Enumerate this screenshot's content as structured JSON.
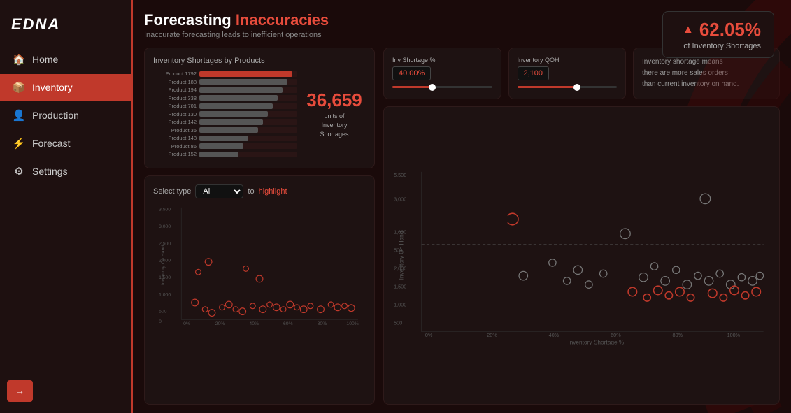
{
  "sidebar": {
    "logo": "EDNA",
    "nav_items": [
      {
        "id": "home",
        "label": "Home",
        "icon": "🏠",
        "active": false
      },
      {
        "id": "inventory",
        "label": "Inventory",
        "icon": "📦",
        "active": true
      },
      {
        "id": "production",
        "label": "Production",
        "icon": "👤",
        "active": false
      },
      {
        "id": "forecast",
        "label": "Forecast",
        "icon": "⚡",
        "active": false
      },
      {
        "id": "settings",
        "label": "Settings",
        "icon": "⚙",
        "active": false
      }
    ],
    "logout_icon": "→"
  },
  "header": {
    "title_plain": "Forecasting ",
    "title_accent": "Inaccuracies",
    "subtitle": "Inaccurate forecasting leads to inefficient operations"
  },
  "badge": {
    "icon": "▲",
    "percent": "62.05%",
    "label": "of Inventory Shortages"
  },
  "inventory_card": {
    "title": "Inventory Shortages by Products",
    "products": [
      {
        "name": "Product 1792",
        "pct": 95
      },
      {
        "name": "Product 188",
        "pct": 90
      },
      {
        "name": "Product 194",
        "pct": 85
      },
      {
        "name": "Product 338",
        "pct": 80
      },
      {
        "name": "Product 701",
        "pct": 75
      },
      {
        "name": "Product 130",
        "pct": 70
      },
      {
        "name": "Product 142",
        "pct": 65
      },
      {
        "name": "Product 35",
        "pct": 60
      },
      {
        "name": "Product 148",
        "pct": 50
      },
      {
        "name": "Product 86",
        "pct": 45
      },
      {
        "name": "Product 152",
        "pct": 40
      }
    ],
    "stat_number": "36,659",
    "stat_label": "units of\nInventory\nShortages"
  },
  "select_type": {
    "label": "Select type",
    "value": "All",
    "highlight_prefix": "to",
    "highlight_value": "highlight"
  },
  "slider_shortage": {
    "title": "Inv Shortage %",
    "value": "40.00%",
    "fill_pct": 40
  },
  "slider_qoh": {
    "title": "Inventory QOH",
    "value": "2,100",
    "fill_pct": 60
  },
  "info_text": "Inventory shortage means\nthere are more sales orders\nthan current inventory on hand.",
  "right_scatter": {
    "y_label": "Inventory On Hand",
    "x_label": "Inventory Shortage %",
    "y_ticks": [
      "5,500",
      "3,000",
      "1,000",
      "500",
      "2,000",
      "1,500",
      "1,000",
      "500"
    ],
    "x_ticks": [
      "0%",
      "20%",
      "40%",
      "60%",
      "80%",
      "100%"
    ],
    "dashed_line_y_pct": 55
  },
  "left_scatter": {
    "y_label": "Inventory On Hand",
    "x_label": "Inventory Shortage %",
    "y_ticks": [
      "3,500",
      "3,000",
      "2,500",
      "2,000",
      "1,500",
      "1,000",
      "500",
      "0"
    ],
    "x_ticks": [
      "0%",
      "20%",
      "40%",
      "60%",
      "80%",
      "100%"
    ]
  }
}
